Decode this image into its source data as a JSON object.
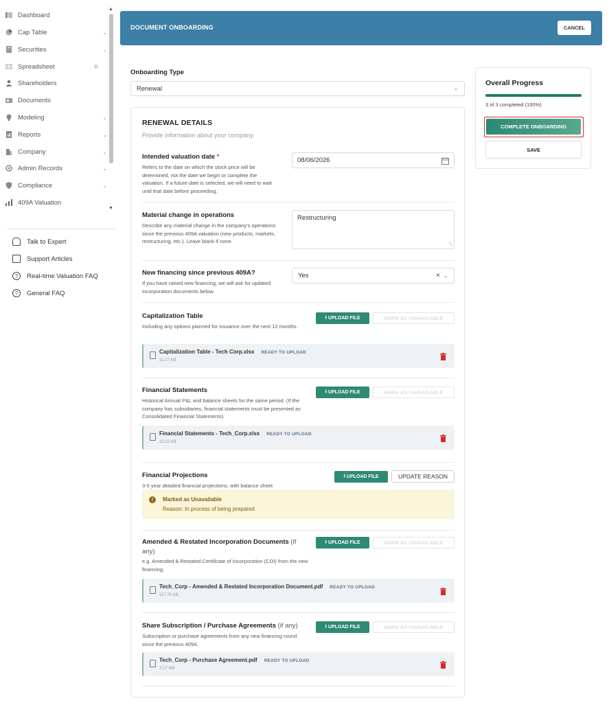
{
  "sidebar": {
    "items": [
      {
        "label": "Dashboard",
        "icon": "dashboard-icon",
        "chevron": false
      },
      {
        "label": "Cap Table",
        "icon": "pie-chart-icon",
        "chevron": true
      },
      {
        "label": "Securities",
        "icon": "document-stack-icon",
        "chevron": true
      },
      {
        "label": "Spreadsheet",
        "icon": "grid-icon",
        "chevron": false,
        "premium": true
      },
      {
        "label": "Shareholders",
        "icon": "person-icon",
        "chevron": false
      },
      {
        "label": "Documents",
        "icon": "folder-icon",
        "chevron": false
      },
      {
        "label": "Modeling",
        "icon": "bulb-icon",
        "chevron": true
      },
      {
        "label": "Reports",
        "icon": "report-icon",
        "chevron": true
      },
      {
        "label": "Company",
        "icon": "building-icon",
        "chevron": true
      },
      {
        "label": "Admin Records",
        "icon": "records-icon",
        "chevron": true
      },
      {
        "label": "Compliance",
        "icon": "shield-icon",
        "chevron": true
      },
      {
        "label": "409A Valuation",
        "icon": "valuation-icon",
        "chevron": false
      }
    ],
    "help": [
      {
        "label": "Talk to Expert",
        "icon": "headset-icon"
      },
      {
        "label": "Support Articles",
        "icon": "book-icon"
      },
      {
        "label": "Real-time Valuation FAQ",
        "icon": "question-icon"
      },
      {
        "label": "General FAQ",
        "icon": "question-icon"
      }
    ]
  },
  "header": {
    "title": "DOCUMENT ONBOARDING",
    "cancel_label": "CANCEL"
  },
  "onboarding": {
    "label": "Onboarding Type",
    "value": "Renewal"
  },
  "details": {
    "title": "RENEWAL DETAILS",
    "subtitle": "Provide information about your company.",
    "valuation_date": {
      "label": "Intended valuation date",
      "required_mark": "*",
      "desc": "Refers to the date on which the stock price will be determined, not the date we begin or complete the valuation. If a future date is selected, we will need to wait until that date before proceeding.",
      "value": "08/06/2026"
    },
    "material_change": {
      "label": "Material change in operations",
      "desc": "Describe any material change in the company's operations since the previous 409A valuation (new products, markets, restructuring, etc.). Leave blank if none.",
      "value": "Restructuring"
    },
    "new_financing": {
      "label": "New financing since previous 409A?",
      "desc": "If you have raised new financing, we will ask for updated incorporation documents below.",
      "value": "Yes"
    }
  },
  "documents": [
    {
      "title": "Capitalization Table",
      "title_suffix": "",
      "desc": "Including any options planned for issuance over the next 12 months.",
      "upload_label": "UPLOAD FILE",
      "unavailable_label": "MARK AS UNAVAILABLE",
      "file": {
        "name": "Capitalization Table - Tech Corp.xlsx",
        "status": "READY TO UPLOAD",
        "size": "32.27 KB"
      }
    },
    {
      "title": "Financial Statements",
      "title_suffix": "",
      "desc": "Historical Annual P&L and balance sheets for the same period. (If the company has subsidiaries, financial statements must be presented as Consolidated Financial Statements)",
      "upload_label": "UPLOAD FILE",
      "unavailable_label": "MARK AS UNAVAILABLE",
      "file": {
        "name": "Financial Statements - Tech_Corp.xlsx",
        "status": "READY TO UPLOAD",
        "size": "10.22 KB"
      }
    },
    {
      "title": "Financial Projections",
      "title_suffix": "",
      "desc": "3-5 year detailed financial projections, with balance sheet",
      "upload_label": "UPLOAD FILE",
      "update_label": "UPDATE REASON",
      "notice": {
        "title": "Marked as Unavailable",
        "reason": "Reason: In process of being prepared"
      }
    },
    {
      "title": "Amended & Restated Incorporation Documents",
      "title_suffix": "(if any)",
      "desc": "e.g. Amended & Restated Certificate of Incorporation (COI) from the new financing.",
      "upload_label": "UPLOAD FILE",
      "unavailable_label": "MARK AS UNAVAILABLE",
      "file": {
        "name": "Tech_Corp - Amended & Restated Incorporation Document.pdf",
        "status": "READY TO UPLOAD",
        "size": "117.78 KB"
      }
    },
    {
      "title": "Share Subscription / Purchase Agreements",
      "title_suffix": "(if any)",
      "desc": "Subscription or purchase agreements from any new financing round since the previous 409A.",
      "upload_label": "UPLOAD FILE",
      "unavailable_label": "MARK AS UNAVAILABLE",
      "file": {
        "name": "Tech_Corp - Purchase Agreement.pdf",
        "status": "READY TO UPLOAD",
        "size": "2.17 MB"
      }
    }
  ],
  "progress": {
    "title": "Overall Progress",
    "status_text": "3 of 3 completed (100%)",
    "fraction": 1.0,
    "complete_label": "COMPLETE ONBOARDING",
    "save_label": "SAVE"
  },
  "colors": {
    "header": "#3b7ea6",
    "accent": "#2f8a73",
    "danger": "#d42b2b",
    "warning_bg": "#faf5d9"
  }
}
